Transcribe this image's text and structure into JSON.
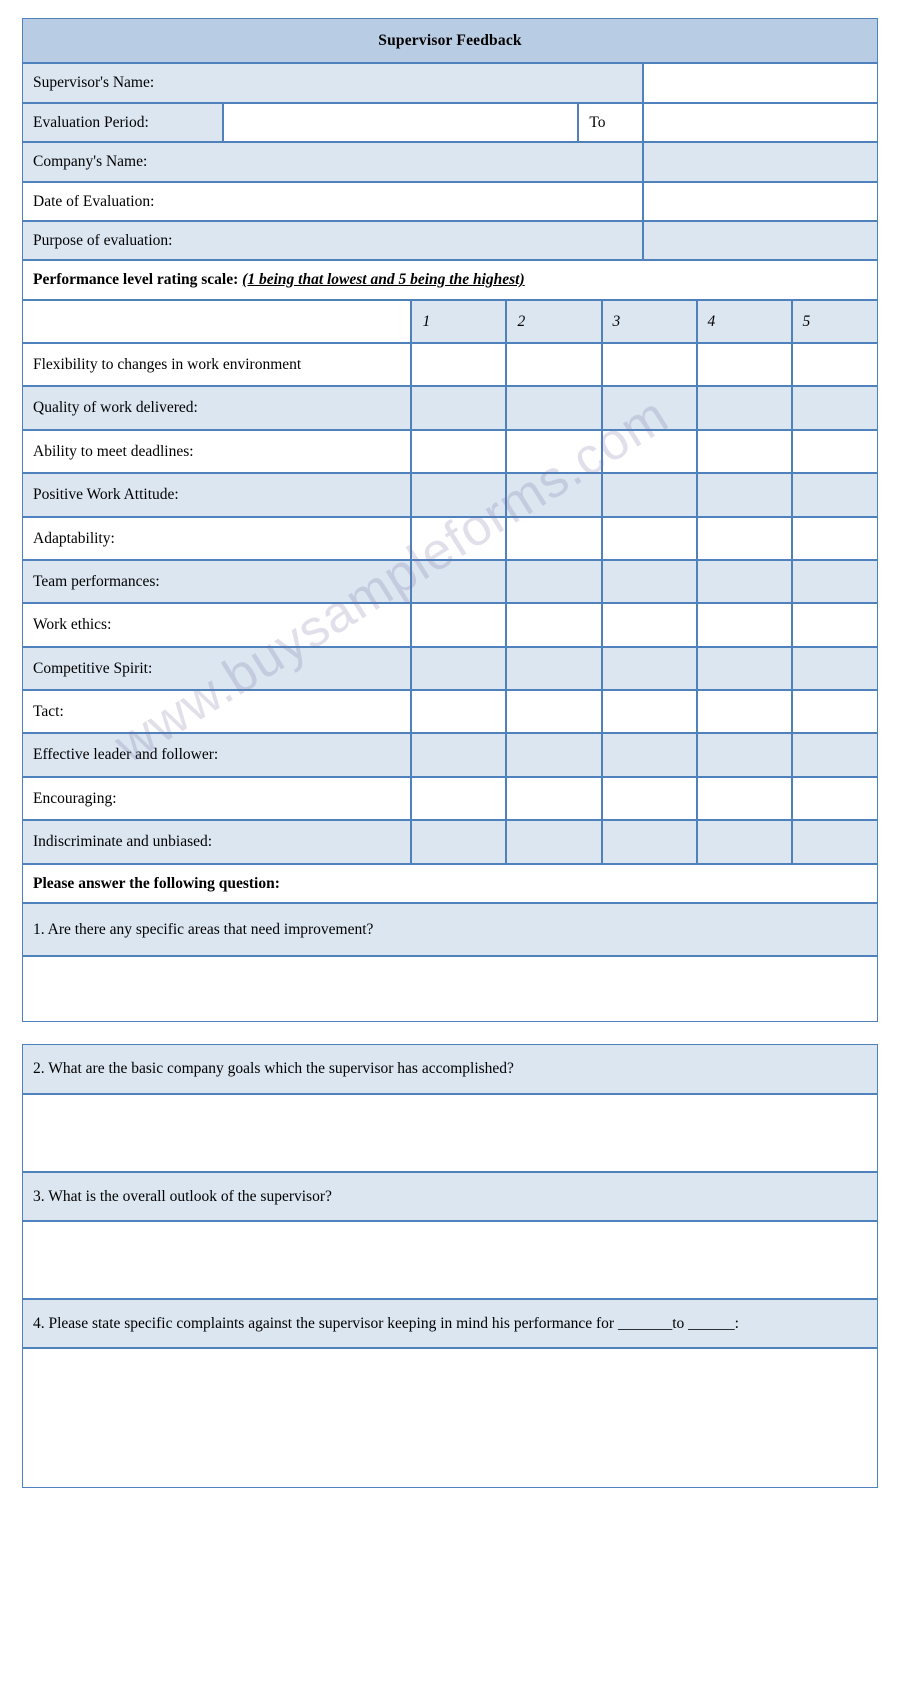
{
  "form": {
    "title": "Supervisor Feedback",
    "watermark": "www.buysampleforms.com",
    "fields": [
      {
        "label": "Supervisor's Name:"
      },
      {
        "label": "Evaluation Period:",
        "mid_label": "To"
      },
      {
        "label": "Company's Name:"
      },
      {
        "label": "Date of Evaluation:"
      },
      {
        "label": "Purpose of evaluation:"
      }
    ],
    "scale_note": {
      "bold_prefix": "Performance level rating scale:",
      "underlined_italic": "(1 being that lowest and 5 being the highest)"
    },
    "rating_table": {
      "columns": [
        "1",
        "2",
        "3",
        "4",
        "5"
      ],
      "rows": [
        "Flexibility to changes in work environment",
        "Quality of work delivered:",
        "Ability to meet deadlines:",
        "Positive Work Attitude:",
        "Adaptability:",
        "Team performances:",
        "Work ethics:",
        "Competitive Spirit:",
        "Tact:",
        "Effective leader and follower:",
        "Encouraging:",
        "Indiscriminate and unbiased:"
      ]
    },
    "questions_heading": "Please answer the following question:",
    "questions": [
      "1. Are there any specific areas that need improvement?",
      "2.  What are the basic company goals which the supervisor has accomplished?",
      "3.  What is the overall outlook of the supervisor?",
      "4. Please state specific complaints against the supervisor keeping in mind his performance for _______to ______:"
    ]
  },
  "colors": {
    "border": "#4f81bd",
    "title_fill": "#b8cce4",
    "row_fill": "#dce6f1",
    "white": "#ffffff"
  }
}
